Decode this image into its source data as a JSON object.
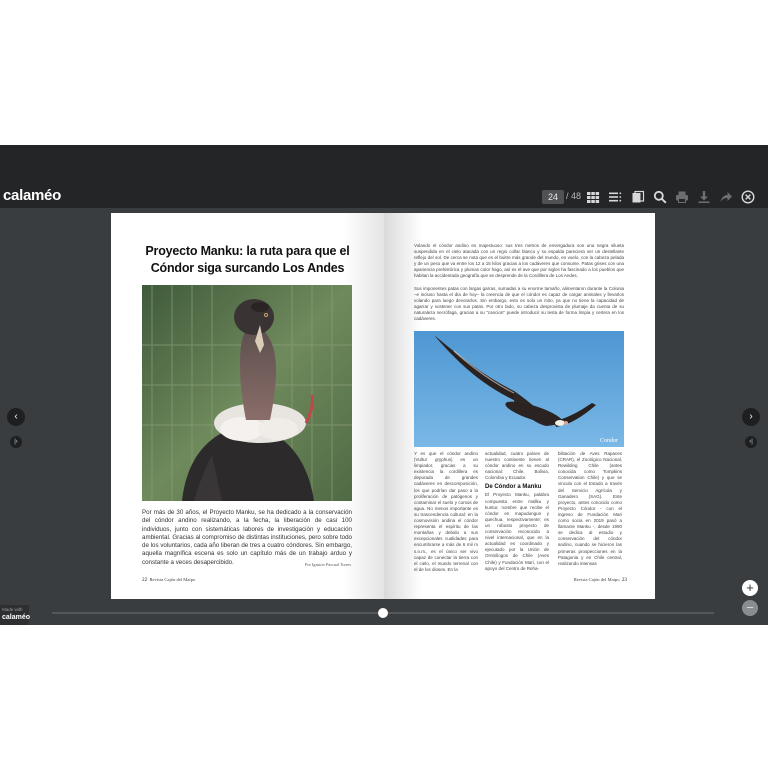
{
  "app": {
    "logo": "calaméo"
  },
  "toolbar": {
    "page_current": "24",
    "page_total": "/ 48"
  },
  "left_page": {
    "title_line1": "Proyecto Manku: la ruta para que el",
    "title_line2": "Cóndor siga surcando Los Andes",
    "lead": "Por más de 30 años, el Proyecto Manku, se ha dedicado a la conservación del cóndor andino realizando, a la fecha, la liberación de casi 100 individuos, junto con sistemáticas labores de investigación y educación ambiental. Gracias al compromiso de distintas instituciones, pero sobre todo de los voluntarios, cada año liberan de tres a cuatro cóndores. Sin embargo, aquella magnífica escena es solo un capítulo más de un trabajo arduo y constante a veces desapercibido.",
    "byline": "Por Ignacio Pascual Torres",
    "page_number": "22",
    "footer": "Revista Cajón del Maipo"
  },
  "right_page": {
    "intro": "Volando el cóndor andino es majestuoso: sus tres metros de envergadura son una negra silueta suspendida en el cielo atacada con un regio collar blanco y su espalda pareciera ser un destellante reflejo del sol. De cerca se nota que es el buitre más grande del mundo, en vuelo, con la cabeza pelada y de un peso que va entre los 12 a 15 kilos gracias a los cadáveres que consume. Patas grises con una apariencia prehistórica y plumas color hago, así es el ave que por siglos ha fascinado a los pueblos que habitan la accidentada geografía que se desprende de la Cordillera de Los Andes.",
    "intro2": "Sus imponentes patas con largas garras, sumadas a su enorme tamaño, alimentaron durante la Colonia –e incluso hasta el día de hoy– la creencia de que el cóndor es capaz de cargar animales y llevarlos volando para luego devorarlos. Sin embargo, esto es solo un mito, ya que no tiene la capacidad de agarrar y sostener con sus patas. Por otro lado, su cabeza desprovista de plumaje da cuenta de su naturaleza necrófaga, gracias a su \"cancion\" puede introducir su testa de forma limpia y certera en los cadáveres.",
    "photo_caption": "Condor",
    "col1": "Y es que el cóndor andino (Vultur gryphus) es un limpiador, gracias a su existencia la cordillera es depurada de grandes cadáveres en descomposición, los que podrían dar paso a la proliferación de patógenos y contaminar el suelo y cursos de agua. No menos importante es su trascendencia cultural: en la cosmovisión andina el cóndor representa el espíritu de las montañas y debido a sus excepcionales cualidades para encumbrarse a más de 6 mil m s.n.m., es el único ser vivo capaz de conectar la tierra con el cielo, el mundo terrenal con el de los dioses. En la",
    "col2a": "actualidad, cuatro países de nuestro continente tienen al cóndor andino en su escudo nacional: Chile, Bolivia, Colombia y Ecuador.",
    "subhead": "De Cóndor a Manku",
    "col2b": "El Proyecto Manku, palabra compuesta entre mallku y kuntur, nombre que recibe el cóndor en mapudungun y quechua, respectivamente; es un robusto proyecto de conservación reconocido a nivel internacional, que en la actualidad es coordinado y ejecutado por la Unión de Ornitólogos de Chile (Aves Chile) y Fundación Mari, con el apoyo del Centro de Reha-",
    "col3": "bilitación de Aves Rapaces (CRAR), el Zoológico Nacional, Rewilding Chile (antes conocida como Tompkins Conservation Chile) y que se vincula con el Estado a través del Servicio Agrícola y Ganadero (SAG). Este proyecto, antes conocido como Proyecto Cóndor - con el ingreso de Fundación Mari como socia en 2019 pasó a llamarse Manku -, desde 1990 se dedica al estudio y conservación del cóndor andino, cuando se hicieron las primeras prospecciones en la Patagonia y en Chile central, realizando intensas",
    "page_number": "23",
    "footer": "Revista Cajón del Maipo"
  },
  "controls": {
    "prev_label": "‹",
    "next_label": "›",
    "first_label": "|‹",
    "last_label": "›|",
    "zoom_in_label": "+",
    "zoom_out_label": "−",
    "madewith_line1": "Made with",
    "madewith_line2": "calaméo"
  },
  "progress": {
    "fraction": 0.5
  }
}
